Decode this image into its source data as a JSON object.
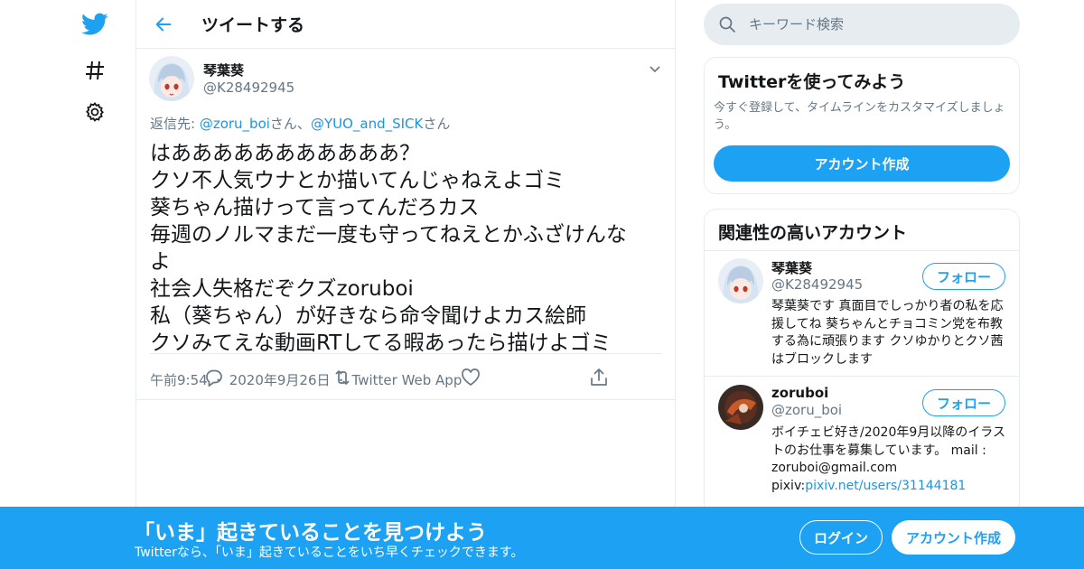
{
  "header": {
    "title": "ツイートする"
  },
  "tweet": {
    "author_name": "琴葉葵",
    "author_handle": "@K28492945",
    "reply_prefix": "返信先: ",
    "reply_user1": "@zoru_boi",
    "reply_mid": "さん、",
    "reply_user2": "@YUO_and_SICK",
    "reply_suffix": "さん",
    "text": "はあああああああああああ？\nクソ不人気ウナとか描いてんじゃねえよゴミ\n葵ちゃん描けって言ってんだろカス\n毎週のノルマまだ一度も守ってねえとかふざけんな\nよ\n社会人失格だぞクズzoruboi\n私（葵ちゃん）が好きなら命令聞けよカス絵師\nクソみてえな動画RTしてる暇あったら描けよゴミ",
    "time": "午前9:54",
    "date": "2020年9月26日",
    "client": "Twitter Web App",
    "sep": "・"
  },
  "search": {
    "placeholder": "キーワード検索"
  },
  "signup_card": {
    "title": "Twitterを使ってみよう",
    "desc": "今すぐ登録して、タイムラインをカスタマイズしましょう。",
    "button": "アカウント作成"
  },
  "related": {
    "title": "関連性の高いアカウント",
    "accounts": [
      {
        "name": "琴葉葵",
        "handle": "@K28492945",
        "follow": "フォロー",
        "bio": "琴葉葵です 真面目でしっかり者の私を応援してね 葵ちゃんとチョコミン党を布教する為に頑張ります クソゆかりとクソ茜はブロックします"
      },
      {
        "name": "zoruboi",
        "handle": "@zoru_boi",
        "follow": "フォロー",
        "bio": "ボイチェビ好き/2020年9月以降のイラストのお仕事を募集しています。 mail : zoruboi@gmail.com pixiv:",
        "bio_link": "pixiv.net/users/31144181"
      }
    ]
  },
  "banner": {
    "title": "「いま」起きていることを見つけよう",
    "sub": "Twitterなら、「いま」起きていることをいち早くチェックできます。",
    "login": "ログイン",
    "signup": "アカウント作成"
  },
  "colors": {
    "accent": "#1da1f2",
    "link": "#1b95e0",
    "muted": "#657786",
    "border": "#e6ecf0"
  }
}
